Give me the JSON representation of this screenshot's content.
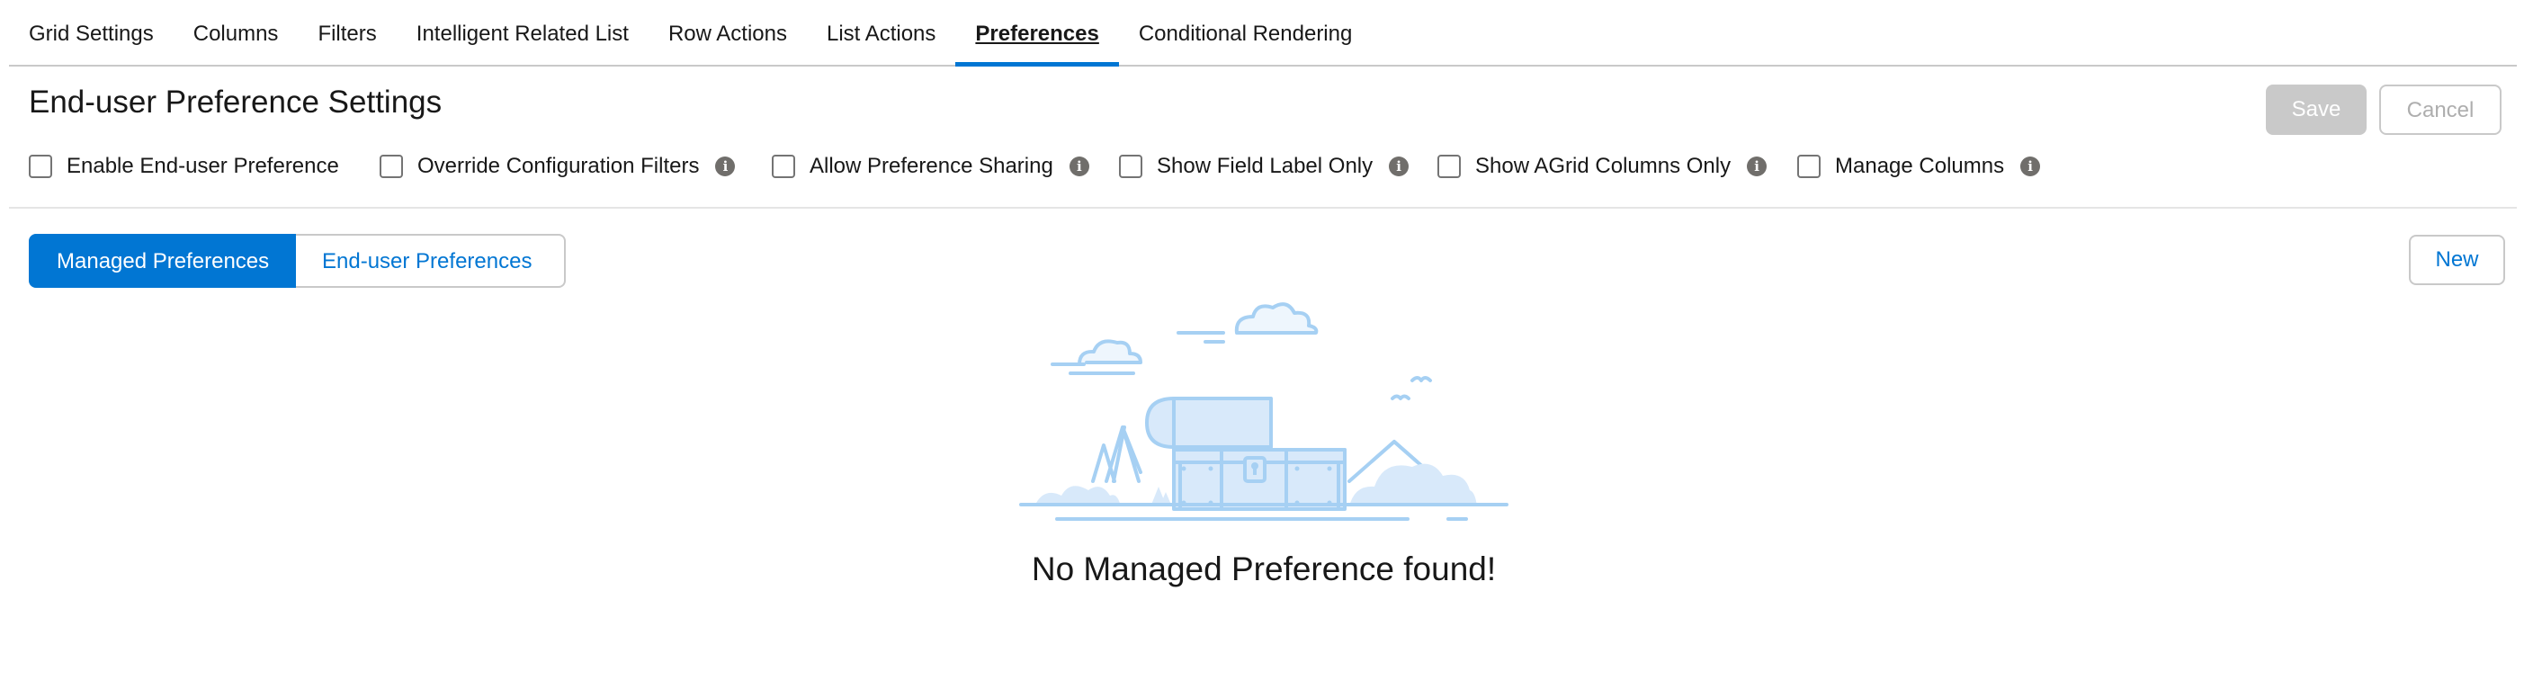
{
  "tabs": [
    {
      "label": "Grid Settings",
      "active": false
    },
    {
      "label": "Columns",
      "active": false
    },
    {
      "label": "Filters",
      "active": false
    },
    {
      "label": "Intelligent Related List",
      "active": false
    },
    {
      "label": "Row Actions",
      "active": false
    },
    {
      "label": "List Actions",
      "active": false
    },
    {
      "label": "Preferences",
      "active": true
    },
    {
      "label": "Conditional Rendering",
      "active": false
    }
  ],
  "settings": {
    "title": "End-user Preference Settings",
    "save_label": "Save",
    "cancel_label": "Cancel",
    "options": [
      {
        "label": "Enable End-user Preference",
        "checked": false,
        "has_info": false
      },
      {
        "label": "Override Configuration Filters",
        "checked": false,
        "has_info": true
      },
      {
        "label": "Allow Preference Sharing",
        "checked": false,
        "has_info": true
      },
      {
        "label": "Show Field Label Only",
        "checked": false,
        "has_info": true
      },
      {
        "label": "Show AGrid Columns Only",
        "checked": false,
        "has_info": true
      },
      {
        "label": "Manage Columns",
        "checked": false,
        "has_info": true
      }
    ]
  },
  "preferences": {
    "segments": [
      {
        "label": "Managed Preferences",
        "active": true
      },
      {
        "label": "End-user Preferences",
        "active": false
      }
    ],
    "new_label": "New",
    "empty_message": "No Managed Preference found!"
  },
  "icons": {
    "info": "info-icon",
    "illustration": "treasure-chest-empty-illustration"
  },
  "colors": {
    "accent": "#0176d3",
    "illustration_fill": "#d8e9fa",
    "illustration_stroke": "#a6d0f3"
  }
}
